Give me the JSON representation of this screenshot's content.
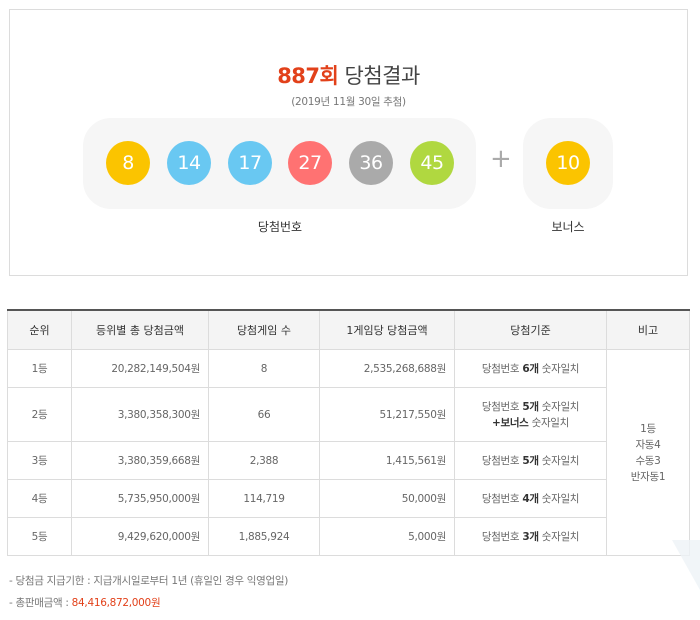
{
  "result": {
    "round": "887회",
    "title_suffix": "당첨결과",
    "draw_date": "(2019년 11월 30일 추첨)",
    "winning_numbers": [
      "8",
      "14",
      "17",
      "27",
      "36",
      "45"
    ],
    "ball_colors": [
      "#fbc400",
      "#69c8f2",
      "#69c8f2",
      "#ff7272",
      "#aaaaaa",
      "#b0d840"
    ],
    "plus": "+",
    "bonus_number": "10",
    "bonus_color": "#fbc400",
    "winning_label": "당첨번호",
    "bonus_label": "보너스"
  },
  "table": {
    "headers": [
      "순위",
      "등위별 총 당첨금액",
      "당첨게임 수",
      "1게임당 당첨금액",
      "당첨기준",
      "비고"
    ],
    "rows": [
      {
        "rank": "1등",
        "total": "20,282,149,504원",
        "count": "8",
        "each": "2,535,268,688원",
        "crit_pre": "당첨번호 ",
        "crit_bold": "6개",
        "crit_post": " 숫자일치",
        "crit_line2_bold": "",
        "crit_line2": ""
      },
      {
        "rank": "2등",
        "total": "3,380,358,300원",
        "count": "66",
        "each": "51,217,550원",
        "crit_pre": "당첨번호 ",
        "crit_bold": "5개",
        "crit_post": " 숫자일치",
        "crit_line2_bold": "+보너스",
        "crit_line2": " 숫자일치"
      },
      {
        "rank": "3등",
        "total": "3,380,359,668원",
        "count": "2,388",
        "each": "1,415,561원",
        "crit_pre": "당첨번호 ",
        "crit_bold": "5개",
        "crit_post": " 숫자일치",
        "crit_line2_bold": "",
        "crit_line2": ""
      },
      {
        "rank": "4등",
        "total": "5,735,950,000원",
        "count": "114,719",
        "each": "50,000원",
        "crit_pre": "당첨번호 ",
        "crit_bold": "4개",
        "crit_post": " 숫자일치",
        "crit_line2_bold": "",
        "crit_line2": ""
      },
      {
        "rank": "5등",
        "total": "9,429,620,000원",
        "count": "1,885,924",
        "each": "5,000원",
        "crit_pre": "당첨번호 ",
        "crit_bold": "3개",
        "crit_post": " 숫자일치",
        "crit_line2_bold": "",
        "crit_line2": ""
      }
    ],
    "note_lines": [
      "1등",
      "자동4",
      "수동3",
      "반자동1"
    ]
  },
  "notes": {
    "deadline": "- 당첨금 지급기한 : 지급개시일로부터 1년 (휴일인 경우 익영업일)",
    "sales_label": "- 총판매금액 : ",
    "sales_amount": "84,416,872,000원"
  }
}
